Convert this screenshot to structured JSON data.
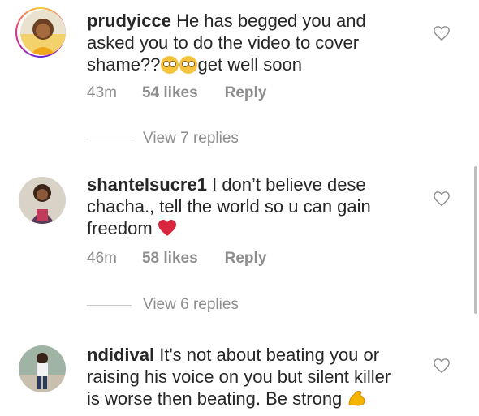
{
  "comments": [
    {
      "username": "prudyicce",
      "text": "He has begged you and asked you to do the video to cover shame??",
      "emoji_trail": [
        "face-with-rolling-eyes",
        "face-with-rolling-eyes"
      ],
      "text_after_emoji": "get well soon",
      "time": "43m",
      "likes": "54 likes",
      "reply": "Reply",
      "view_replies": "View 7 replies",
      "avatar_icon": "avatar-prudyicce",
      "story_ring": true
    },
    {
      "username": "shantelsucre1",
      "text": "I don’t believe dese chacha., tell the world so u can gain freedom",
      "emoji_trail": [
        "red-heart"
      ],
      "time": "46m",
      "likes": "58 likes",
      "reply": "Reply",
      "view_replies": "View 6 replies",
      "avatar_icon": "avatar-shantelsucre1"
    },
    {
      "username": "ndidival",
      "text": "It's not about beating you or raising his voice on you but silent killer is worse then beating. Be strong",
      "emoji_trail": [
        "flexed-biceps"
      ],
      "avatar_icon": "avatar-ndidival"
    }
  ],
  "colors": {
    "text": "#262626",
    "meta": "#8e8e8e",
    "heart": "#ed4956",
    "emoji_yellow": "#f7c33c"
  }
}
